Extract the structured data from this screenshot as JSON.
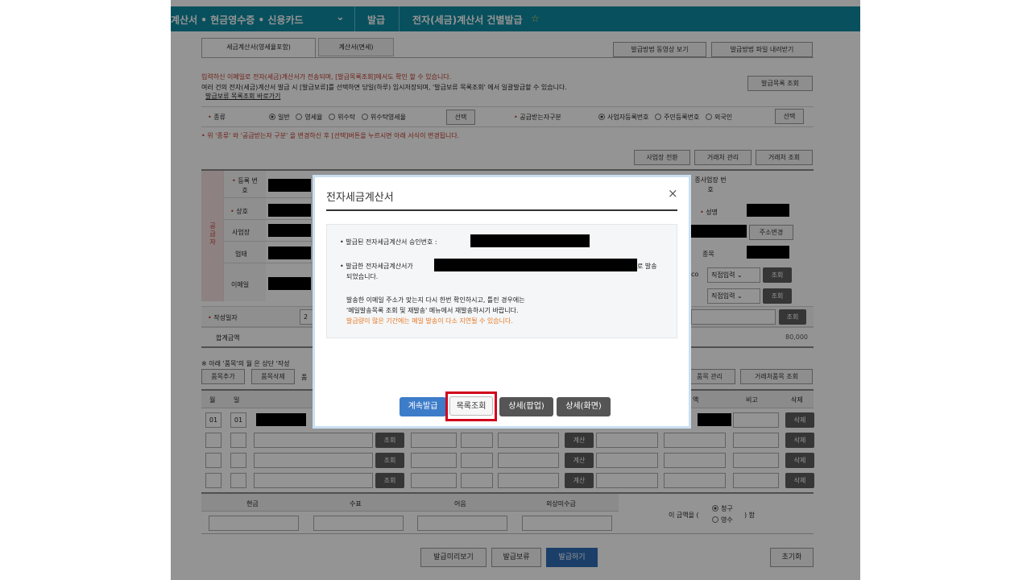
{
  "nav": {
    "menu": "계산서 • 현금영수증 • 신용카드",
    "issue": "발급",
    "current": "전자(세금)계산서 건별발급",
    "star": "☆",
    "chevron": "⌄"
  },
  "tabs": [
    {
      "label": "세금계산서(영세율포함)"
    },
    {
      "label": "계산서(면세)"
    }
  ],
  "top_buttons": {
    "video": "발급방법 동영상 보기",
    "file": "발급방법 파일 내려받기"
  },
  "notice": {
    "line1": "입력하신 이메일로 전자(세금)계산서가 전송되며, [발급목록조회]에서도 확인 할 수 있습니다.",
    "line2": "여러 건의 전자(세금)계산서 발급 시 [발급보류]를 선택하면 당일(하루) 임시저장되며, '발급보류 목록조회' 에서 일괄발급할 수 있습니다.",
    "link": "발급보류 목록조회 바로가기",
    "list_button": "발급목록 조회"
  },
  "type_row": {
    "label": "종류",
    "options": [
      "일반",
      "영세율",
      "위수탁",
      "위수탁영세율"
    ],
    "select": "선택",
    "buyer_label": "공급받는자구분",
    "buyer_options": [
      "사업자등록번호",
      "주민등록번호",
      "외국인"
    ],
    "buyer_select": "선택"
  },
  "warning": "• 위 '종류' 와 '공급받는자 구분' 을 변경하신 후 [선택]버튼을 누르시면 아래 서식이 변경됩니다.",
  "biz_buttons": {
    "switch": "사업장 전환",
    "manage": "거래처 관리",
    "lookup": "거래처 조회"
  },
  "supplier": {
    "side": "공급자",
    "reg_no": "등록 번호",
    "name": "상호",
    "address": "사업장",
    "business": "업태",
    "email": "이메일",
    "sub_biz": "종사업장 번호",
    "owner": "성명",
    "addr_change": "주소변경",
    "item": "종목",
    "email_suffix": "co",
    "direct": "직접입력",
    "lookup": "조회"
  },
  "date_row": {
    "label": "작성일자",
    "prefix": "2",
    "lookup": "조회"
  },
  "total_row": {
    "label": "합계금액",
    "value": "80,000"
  },
  "items_note": "※ 아래 '품목'의 월 은 상단 '작성",
  "items_buttons": {
    "add": "품목추가",
    "delete": "품목삭제",
    "other": "품",
    "manage": "품목 관리",
    "client_list": "거래처품목 조회"
  },
  "table": {
    "headers": [
      "월",
      "일",
      "액",
      "비고",
      "삭제"
    ],
    "first_row": {
      "month": "01",
      "day": "01"
    },
    "lookup": "조회",
    "calc": "계산",
    "delete": "삭제"
  },
  "payment": {
    "headers": [
      "현금",
      "수표",
      "어음",
      "외상미수금"
    ],
    "claim_prefix": "이 금액을 (",
    "claim_options": [
      "청구",
      "영수"
    ],
    "claim_suffix": ") 함"
  },
  "bottom_buttons": {
    "preview": "발급미리보기",
    "hold": "발급보류",
    "issue": "발급하기",
    "reset": "초기화"
  },
  "modal": {
    "title": "전자세금계산서",
    "close": "×",
    "approval": "발급된 전자세금계산서 승인번호 :",
    "sent_prefix": "발급한 전자세금계산서가",
    "sent_suffix": "로 발송",
    "sent_line2": "되었습니다.",
    "check1": "발송한 이메일 주소가 맞는지 다시 한번 확인하시고, 틀린 경우에는",
    "check2": "'메일발송목록 조회 및 재발송' 메뉴에서 재발송하시기 바랍니다.",
    "delay": "발급량이 많은 기간에는 메일 발송이 다소 지연될 수 있습니다.",
    "buttons": {
      "continue": "계속발급",
      "list": "목록조회",
      "popup": "상세(팝업)",
      "screen": "상세(화면)"
    },
    "colors": {
      "continue": "#3d7cc9",
      "dark": "#555555",
      "highlight": "#d0021b",
      "delay": "#e87722"
    }
  }
}
